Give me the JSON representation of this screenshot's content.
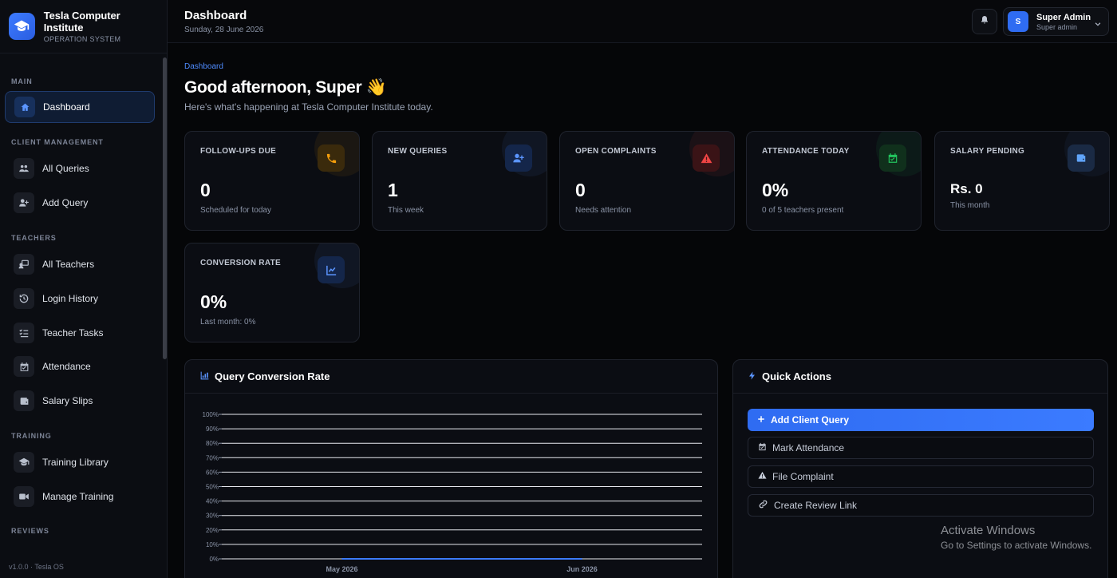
{
  "brand": {
    "title": "Tesla Computer Institute",
    "subtitle": "OPERATION SYSTEM"
  },
  "sidebar": {
    "sections": [
      {
        "label": "MAIN"
      },
      {
        "label": "CLIENT MANAGEMENT"
      },
      {
        "label": "TEACHERS"
      },
      {
        "label": "TRAINING"
      },
      {
        "label": "REVIEWS"
      }
    ],
    "items": [
      {
        "label": "Dashboard",
        "icon": "home-icon",
        "active": true
      },
      {
        "label": "All Queries",
        "icon": "users-icon"
      },
      {
        "label": "Add Query",
        "icon": "user-plus-icon"
      },
      {
        "label": "All Teachers",
        "icon": "chalkboard-teacher-icon"
      },
      {
        "label": "Login History",
        "icon": "history-icon"
      },
      {
        "label": "Teacher Tasks",
        "icon": "task-list-icon"
      },
      {
        "label": "Attendance",
        "icon": "calendar-check-icon"
      },
      {
        "label": "Salary Slips",
        "icon": "wallet-icon"
      },
      {
        "label": "Training Library",
        "icon": "graduation-cap-icon"
      },
      {
        "label": "Manage Training",
        "icon": "video-icon"
      }
    ],
    "version": "v1.0.0 · Tesla OS"
  },
  "header": {
    "title": "Dashboard",
    "date": "Sunday, 28 June 2026",
    "user": {
      "name": "Super Admin",
      "role": "Super admin",
      "initial": "S"
    }
  },
  "main": {
    "breadcrumb": "Dashboard",
    "greeting": "Good afternoon, Super 👋",
    "greeting_sub": "Here's what's happening at Tesla Computer Institute today."
  },
  "stats": [
    {
      "label": "FOLLOW-UPS DUE",
      "value": "0",
      "note": "Scheduled for today",
      "icon": "phone-icon",
      "color": "#f59e0b"
    },
    {
      "label": "NEW QUERIES",
      "value": "1",
      "note": "This week",
      "icon": "user-plus-icon",
      "color": "#4f8cff"
    },
    {
      "label": "OPEN COMPLAINTS",
      "value": "0",
      "note": "Needs attention",
      "icon": "warning-icon",
      "color": "#ef4444"
    },
    {
      "label": "ATTENDANCE TODAY",
      "value": "0%",
      "note": "0 of 5 teachers present",
      "icon": "calendar-check-icon",
      "color": "#22c55e"
    },
    {
      "label": "SALARY PENDING",
      "value": "Rs. 0",
      "note": "This month",
      "icon": "wallet-icon",
      "color": "#60a5fa"
    },
    {
      "label": "CONVERSION RATE",
      "value": "0%",
      "note": "Last month: 0%",
      "icon": "line-chart-icon",
      "color": "#4f8cff"
    }
  ],
  "chart_panel": {
    "title": "Query Conversion Rate"
  },
  "chart_data": {
    "type": "line",
    "x": [
      "May 2026",
      "Jun 2026"
    ],
    "series": [
      {
        "values": [
          0,
          0
        ]
      }
    ],
    "yticks": [
      "0%",
      "10%",
      "20%",
      "30%",
      "40%",
      "50%",
      "60%",
      "70%",
      "80%",
      "90%",
      "100%"
    ],
    "ylim": [
      0,
      100
    ],
    "grid": true
  },
  "quick_actions": {
    "title": "Quick Actions",
    "items": [
      {
        "label": "Add Client Query",
        "icon": "plus-icon",
        "primary": true
      },
      {
        "label": "Mark Attendance",
        "icon": "calendar-check-icon"
      },
      {
        "label": "File Complaint",
        "icon": "warning-icon"
      },
      {
        "label": "Create Review Link",
        "icon": "link-icon"
      }
    ]
  },
  "watermark": {
    "line1": "Activate Windows",
    "line2": "Go to Settings to activate Windows."
  }
}
